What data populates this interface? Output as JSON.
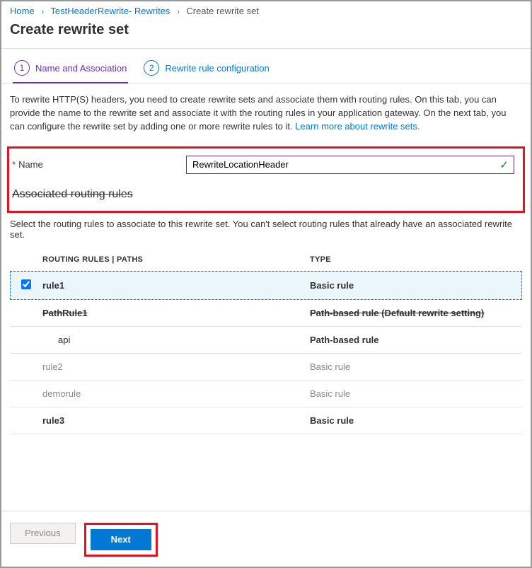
{
  "breadcrumb": {
    "home": "Home",
    "mid": "TestHeaderRewrite- Rewrites",
    "current": "Create rewrite set"
  },
  "page_title": "Create rewrite set",
  "tabs": {
    "step1": "Name and Association",
    "step2": "Rewrite rule configuration"
  },
  "intro_text": "To rewrite HTTP(S) headers, you need to create rewrite sets and associate them with routing rules. On this tab, you can provide the name to the rewrite set and associate it with the routing rules in your application gateway. On the next tab, you can configure the rewrite set by adding one or more rewrite rules to it.  ",
  "intro_link": "Learn more about rewrite sets.",
  "name_label": "Name",
  "name_value": "RewriteLocationHeader",
  "section_h": "Associated routing rules",
  "section_desc": "Select the routing rules to associate to this rewrite set. You can't select routing rules that already have an associated rewrite set.",
  "columns": {
    "name": "ROUTING RULES | PATHS",
    "type": "TYPE"
  },
  "rows": [
    {
      "checked": true,
      "selected": true,
      "disabled": false,
      "strike": false,
      "indent": false,
      "name": "rule1",
      "type": "Basic rule"
    },
    {
      "checked": false,
      "selected": false,
      "disabled": false,
      "strike": true,
      "indent": false,
      "name": "PathRule1",
      "type": "Path-based rule (Default rewrite setting)"
    },
    {
      "checked": false,
      "selected": false,
      "disabled": false,
      "strike": false,
      "indent": true,
      "name": "api",
      "type": "Path-based rule"
    },
    {
      "checked": false,
      "selected": false,
      "disabled": true,
      "strike": false,
      "indent": false,
      "name": "rule2",
      "type": "Basic rule"
    },
    {
      "checked": false,
      "selected": false,
      "disabled": true,
      "strike": false,
      "indent": false,
      "name": "demorule",
      "type": "Basic rule"
    },
    {
      "checked": false,
      "selected": false,
      "disabled": false,
      "strike": false,
      "indent": false,
      "name": "rule3",
      "type": "Basic rule"
    }
  ],
  "buttons": {
    "prev": "Previous",
    "next": "Next"
  }
}
